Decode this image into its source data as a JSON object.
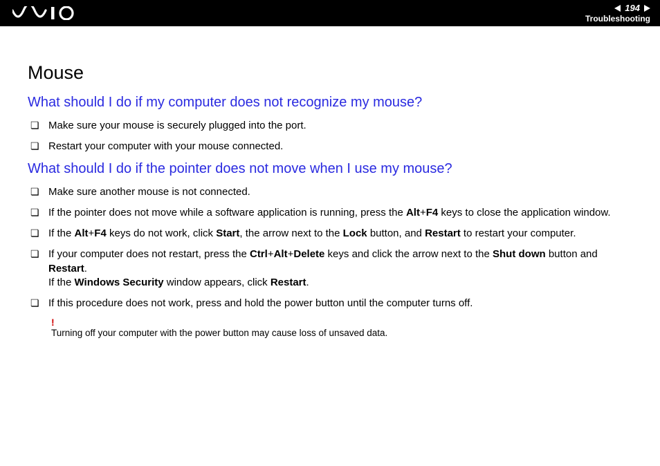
{
  "header": {
    "page_number": "194",
    "section_name": "Troubleshooting"
  },
  "content": {
    "main_heading": "Mouse",
    "section1": {
      "heading": "What should I do if my computer does not recognize my mouse?",
      "items": [
        "Make sure your mouse is securely plugged into the port.",
        "Restart your computer with your mouse connected."
      ]
    },
    "section2": {
      "heading": "What should I do if the pointer does not move when I use my mouse?",
      "items_html": [
        "Make sure another mouse is not connected.",
        "If the pointer does not move while a software application is running, press the <b>Alt</b>+<b>F4</b> keys to close the application window.",
        "If the <b>Alt</b>+<b>F4</b> keys do not work, click <b>Start</b>, the arrow next to the <b>Lock</b> button, and <b>Restart</b> to restart your computer.",
        "If your computer does not restart, press the <b>Ctrl</b>+<b>Alt</b>+<b>Delete</b> keys and click the arrow next to the <b>Shut down</b> button and <b>Restart</b>.<br>If the <b>Windows Security</b> window appears, click <b>Restart</b>.",
        "If this procedure does not work, press and hold the power button until the computer turns off."
      ]
    },
    "warning": {
      "mark": "!",
      "text": "Turning off your computer with the power button may cause loss of unsaved data."
    }
  }
}
